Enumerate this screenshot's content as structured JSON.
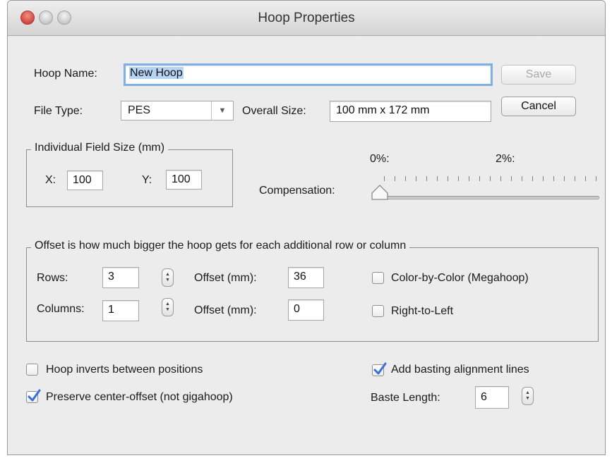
{
  "window": {
    "title": "Hoop Properties"
  },
  "hoop_name": {
    "label": "Hoop Name:",
    "value": "New Hoop"
  },
  "buttons": {
    "save": "Save",
    "cancel": "Cancel"
  },
  "file_type": {
    "label": "File Type:",
    "value": "PES"
  },
  "overall_size": {
    "label": "Overall Size:",
    "value": "100 mm x 172 mm"
  },
  "field_size": {
    "legend": "Individual Field Size (mm)",
    "x_label": "X:",
    "x_value": "100",
    "y_label": "Y:",
    "y_value": "100"
  },
  "compensation": {
    "label": "Compensation:",
    "min_label": "0%:",
    "max_label": "2%:",
    "value_percent": 0
  },
  "offset_group": {
    "legend": "Offset is how much bigger the hoop gets for each additional row or column",
    "rows_label": "Rows:",
    "rows_value": "3",
    "rows_offset_label": "Offset (mm):",
    "rows_offset_value": "36",
    "columns_label": "Columns:",
    "columns_value": "1",
    "columns_offset_label": "Offset (mm):",
    "columns_offset_value": "0",
    "color_by_color": {
      "label": "Color-by-Color (Megahoop)",
      "checked": false
    },
    "right_to_left": {
      "label": "Right-to-Left",
      "checked": false
    }
  },
  "options": {
    "hoop_inverts": {
      "label": "Hoop inverts between positions",
      "checked": false
    },
    "preserve_center": {
      "label": "Preserve center-offset (not gigahoop)",
      "checked": true
    },
    "add_basting": {
      "label": "Add basting alignment lines",
      "checked": true
    }
  },
  "baste_length": {
    "label": "Baste Length:",
    "value": "6"
  },
  "colors": {
    "accent": "#3b6fd1",
    "focus_ring": "#7eb0e6",
    "close_button": "#d0473f"
  }
}
